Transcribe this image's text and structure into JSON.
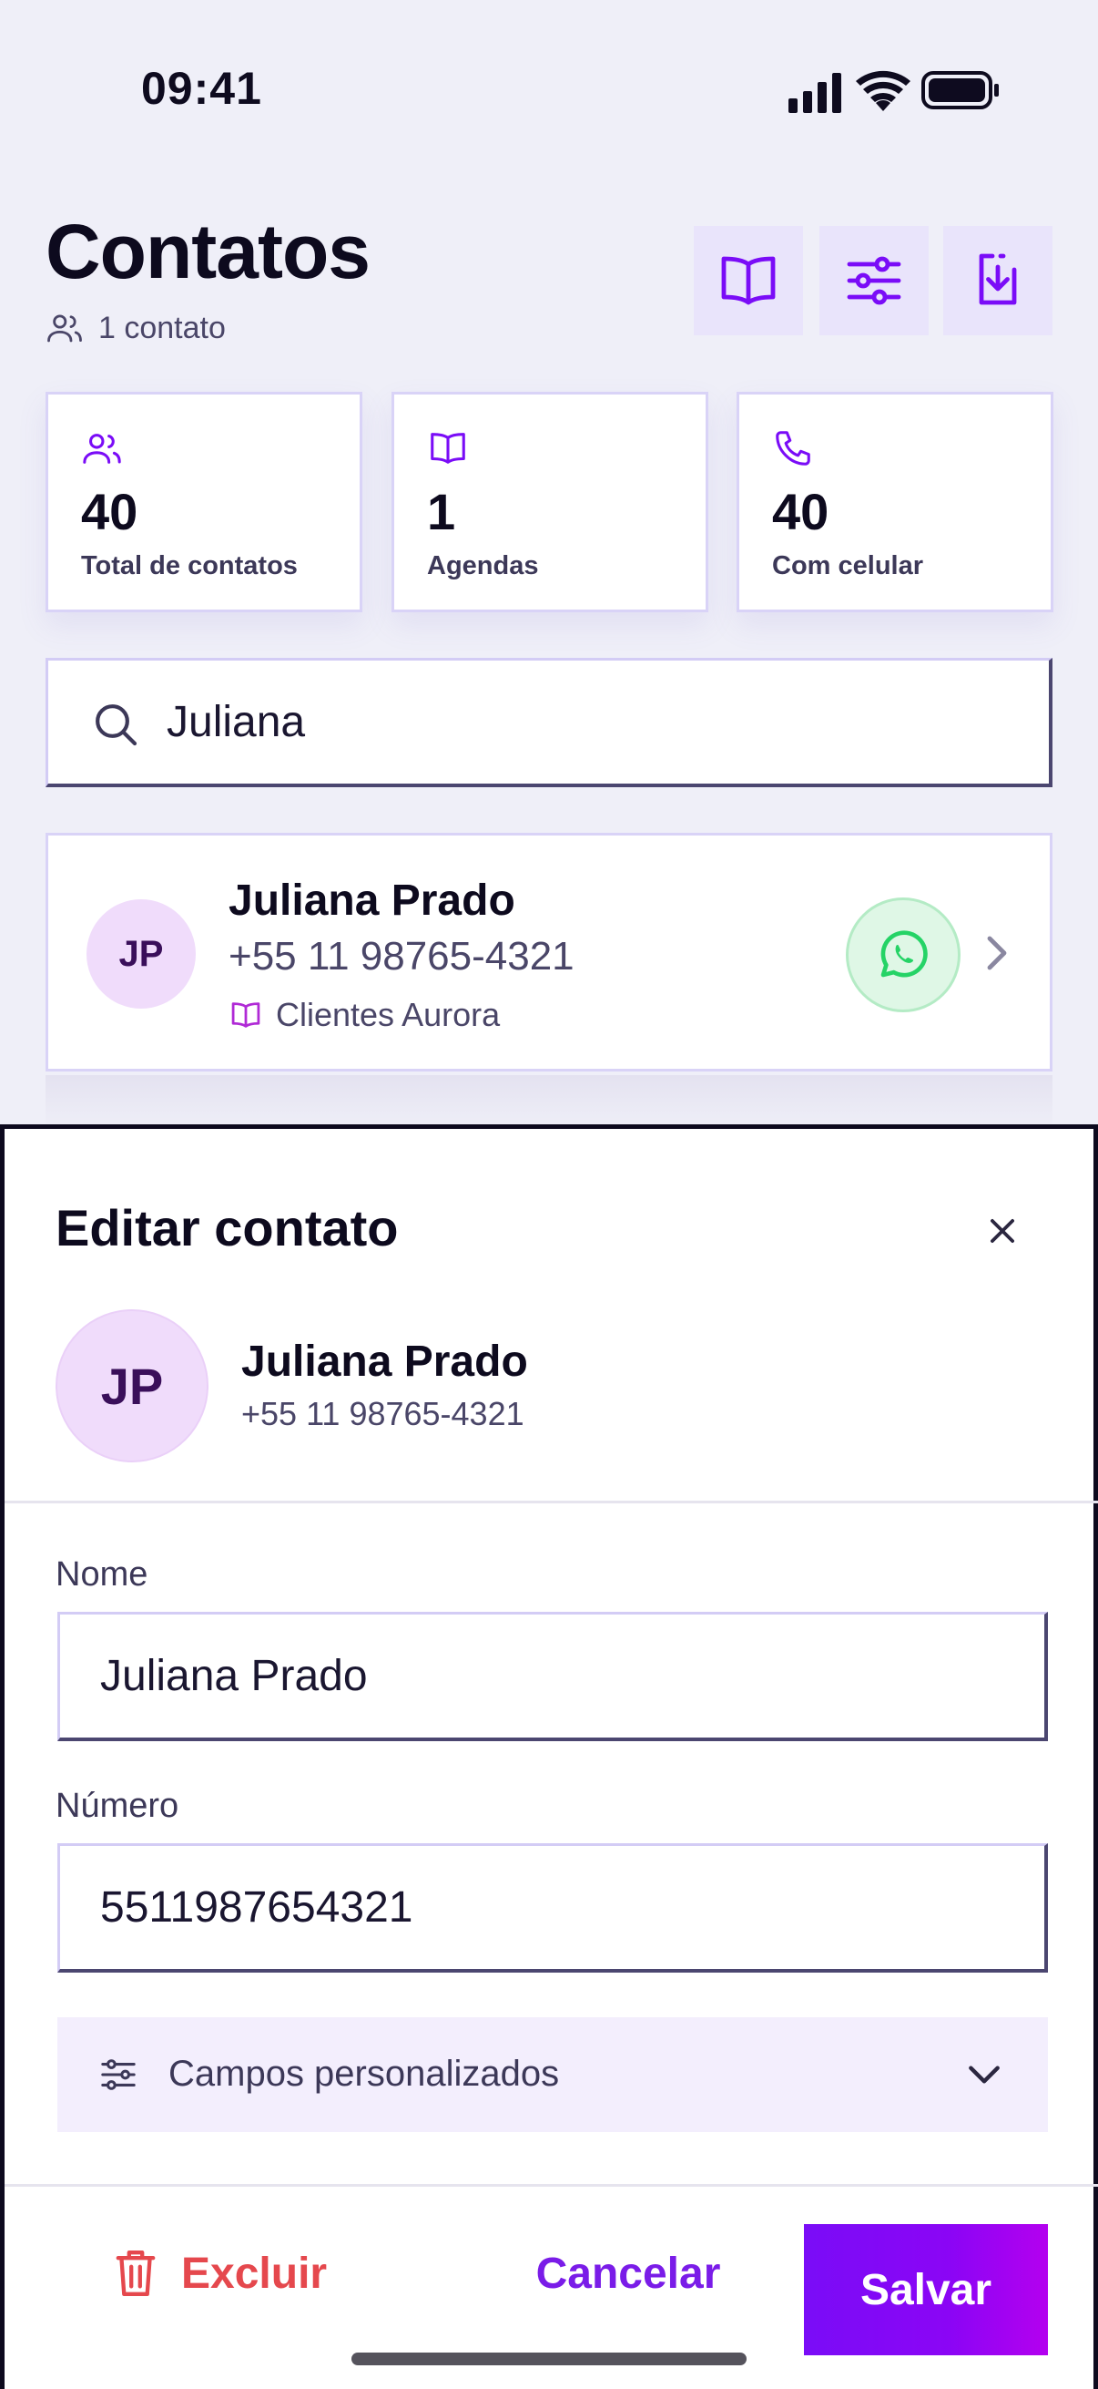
{
  "status_bar": {
    "time": "09:41"
  },
  "header": {
    "title": "Contatos",
    "subtitle": "1 contato",
    "buttons": [
      "book-icon",
      "sliders-icon",
      "download-icon"
    ]
  },
  "stats": [
    {
      "icon": "users-icon",
      "value": "40",
      "label": "Total de contatos"
    },
    {
      "icon": "book-icon",
      "value": "1",
      "label": "Agendas"
    },
    {
      "icon": "phone-icon",
      "value": "40",
      "label": "Com celular"
    }
  ],
  "search": {
    "value": "Juliana"
  },
  "contact_card": {
    "initials": "JP",
    "name": "Juliana Prado",
    "phone": "+55 11 98765-4321",
    "agenda": "Clientes Aurora"
  },
  "sheet": {
    "title": "Editar contato",
    "initials": "JP",
    "name": "Juliana Prado",
    "phone": "+55 11 98765-4321",
    "name_label": "Nome",
    "name_value": "Juliana Prado",
    "number_label": "Número",
    "number_value": "5511987654321",
    "custom_fields_label": "Campos personalizados",
    "delete_label": "Excluir",
    "cancel_label": "Cancelar",
    "save_label": "Salvar"
  },
  "colors": {
    "accent": "#7a0cf7",
    "danger": "#e5484d",
    "whatsapp": "#25d366",
    "background": "#efeff8"
  }
}
